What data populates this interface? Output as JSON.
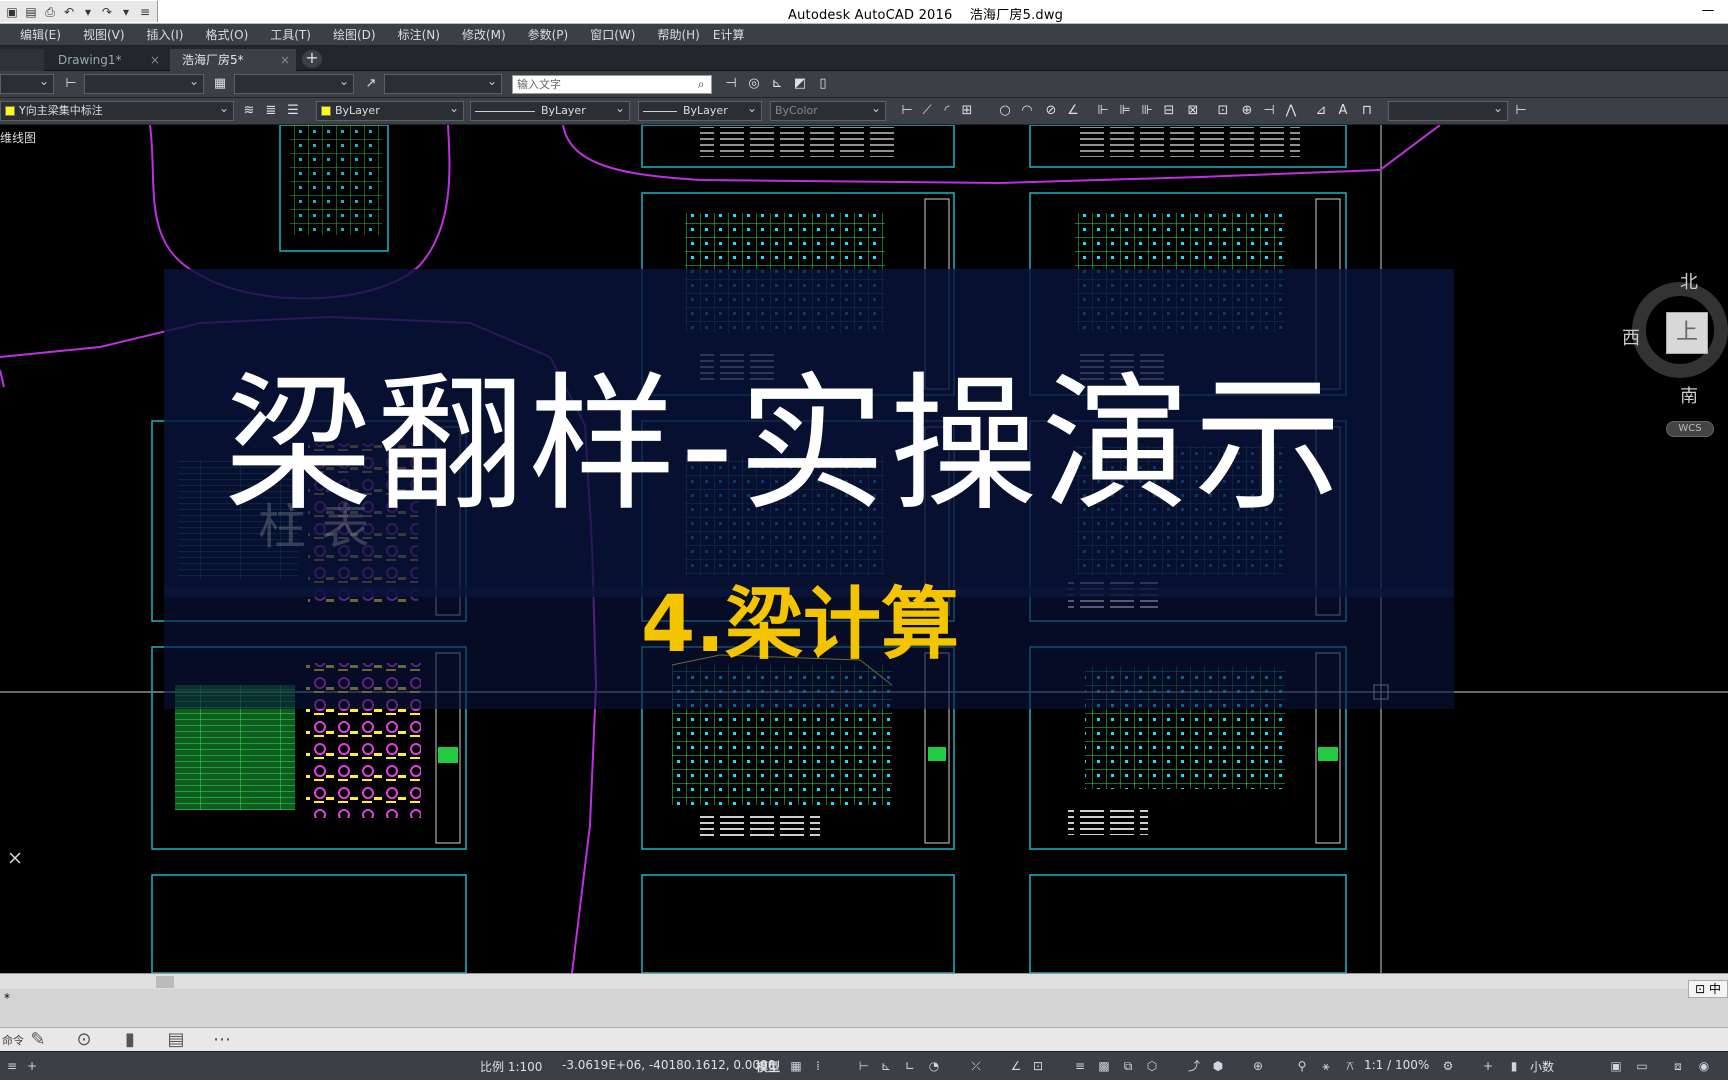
{
  "titlebar": {
    "app_title": "Autodesk AutoCAD 2016",
    "file_name": "浩海厂房5.dwg",
    "minimize": "—",
    "maximize": "☐",
    "close": "✕"
  },
  "menu": [
    "编辑(E)",
    "视图(V)",
    "插入(I)",
    "格式(O)",
    "工具(T)",
    "绘图(D)",
    "标注(N)",
    "修改(M)",
    "参数(P)",
    "窗口(W)",
    "帮助(H)",
    "E计算"
  ],
  "tabs": [
    {
      "label": "Drawing1*",
      "close": "×"
    },
    {
      "label": "浩海厂房5*",
      "close": "×"
    }
  ],
  "toolbar1": {
    "search_placeholder": "输入文字"
  },
  "toolbar2": {
    "layer": "Y向主梁集中标注",
    "color": "ByLayer",
    "linetype": "ByLayer",
    "lineweight": "ByLayer",
    "plotstyle": "ByColor"
  },
  "canvas": {
    "view_label": "维线图",
    "watermark": "柱 表",
    "overlay_title": "梁翻样-实操演示",
    "overlay_subtitle": "4.梁计算",
    "colors": {
      "accent": "#f5c400",
      "frame": "#1ab3c6",
      "boundary": "#c030e0",
      "grid": "#33ff66"
    }
  },
  "viewcube": {
    "north": "北",
    "west": "西",
    "south": "南",
    "face": "上",
    "wcs": "WCS"
  },
  "command": {
    "history": "*",
    "prompt": "命令",
    "ime": "中"
  },
  "statusbar": {
    "scale": "比例 1:100",
    "coords": "-3.0619E+06, -40180.1612, 0.0000",
    "model": "模型",
    "anno_scale": "1:1 / 100%",
    "units": "小数"
  }
}
